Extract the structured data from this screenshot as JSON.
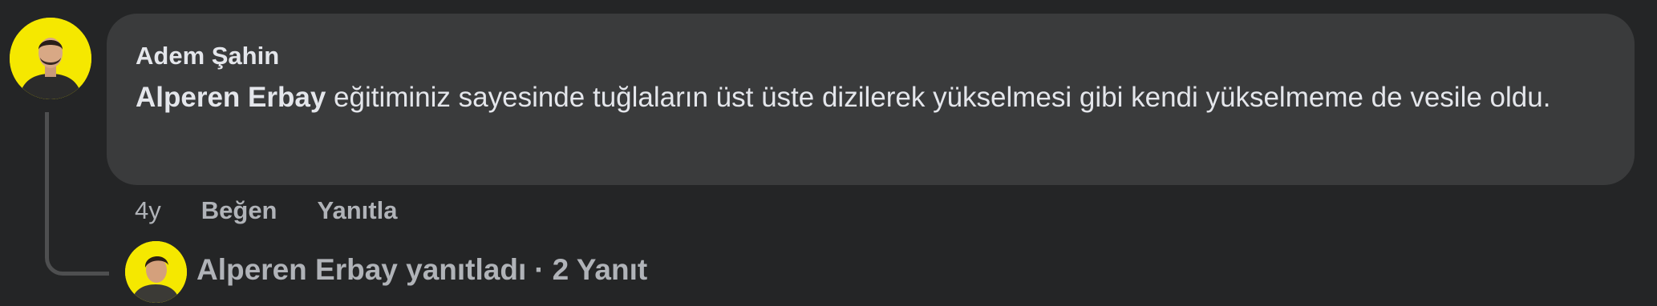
{
  "comment": {
    "author": "Adem Şahin",
    "mention": "Alperen Erbay",
    "text": " eğitiminiz sayesinde tuğlaların üst üste dizilerek yükselmesi gibi kendi yükselmeme de vesile oldu."
  },
  "actions": {
    "time": "4y",
    "like_label": "Beğen",
    "reply_label": "Yanıtla"
  },
  "replies": {
    "text": "Alperen Erbay yanıtladı",
    "separator": "·",
    "count_label": "2 Yanıt"
  },
  "colors": {
    "background": "#242526",
    "bubble": "#3a3b3c",
    "avatar_bg": "#f5e800",
    "text_primary": "#e4e6eb",
    "text_secondary": "#b0b3b8"
  }
}
